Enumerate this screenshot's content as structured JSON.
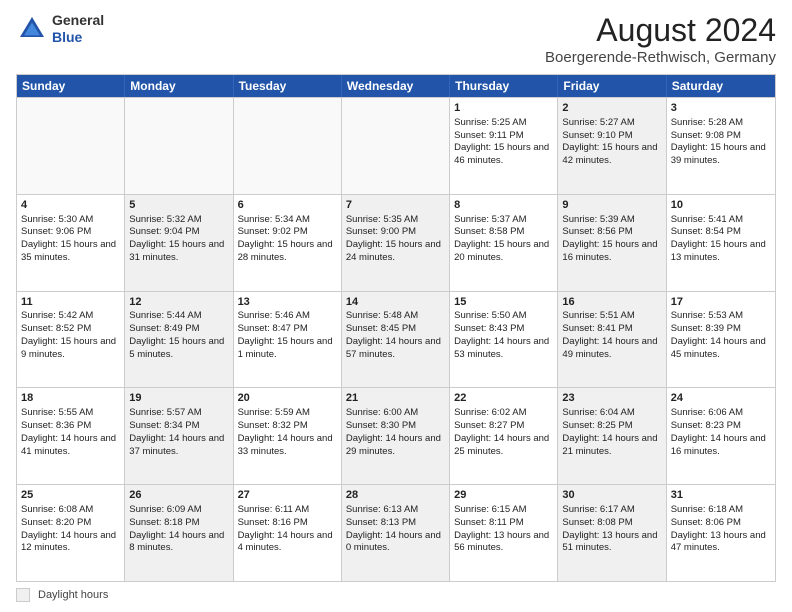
{
  "header": {
    "logo": {
      "line1": "General",
      "line2": "Blue"
    },
    "title": "August 2024",
    "subtitle": "Boergerende-Rethwisch, Germany"
  },
  "weekdays": [
    "Sunday",
    "Monday",
    "Tuesday",
    "Wednesday",
    "Thursday",
    "Friday",
    "Saturday"
  ],
  "rows": [
    [
      {
        "day": "",
        "info": "",
        "shaded": false,
        "empty": true
      },
      {
        "day": "",
        "info": "",
        "shaded": false,
        "empty": true
      },
      {
        "day": "",
        "info": "",
        "shaded": false,
        "empty": true
      },
      {
        "day": "",
        "info": "",
        "shaded": false,
        "empty": true
      },
      {
        "day": "1",
        "info": "Sunrise: 5:25 AM\nSunset: 9:11 PM\nDaylight: 15 hours and 46 minutes.",
        "shaded": false,
        "empty": false
      },
      {
        "day": "2",
        "info": "Sunrise: 5:27 AM\nSunset: 9:10 PM\nDaylight: 15 hours and 42 minutes.",
        "shaded": true,
        "empty": false
      },
      {
        "day": "3",
        "info": "Sunrise: 5:28 AM\nSunset: 9:08 PM\nDaylight: 15 hours and 39 minutes.",
        "shaded": false,
        "empty": false
      }
    ],
    [
      {
        "day": "4",
        "info": "Sunrise: 5:30 AM\nSunset: 9:06 PM\nDaylight: 15 hours and 35 minutes.",
        "shaded": false,
        "empty": false
      },
      {
        "day": "5",
        "info": "Sunrise: 5:32 AM\nSunset: 9:04 PM\nDaylight: 15 hours and 31 minutes.",
        "shaded": true,
        "empty": false
      },
      {
        "day": "6",
        "info": "Sunrise: 5:34 AM\nSunset: 9:02 PM\nDaylight: 15 hours and 28 minutes.",
        "shaded": false,
        "empty": false
      },
      {
        "day": "7",
        "info": "Sunrise: 5:35 AM\nSunset: 9:00 PM\nDaylight: 15 hours and 24 minutes.",
        "shaded": true,
        "empty": false
      },
      {
        "day": "8",
        "info": "Sunrise: 5:37 AM\nSunset: 8:58 PM\nDaylight: 15 hours and 20 minutes.",
        "shaded": false,
        "empty": false
      },
      {
        "day": "9",
        "info": "Sunrise: 5:39 AM\nSunset: 8:56 PM\nDaylight: 15 hours and 16 minutes.",
        "shaded": true,
        "empty": false
      },
      {
        "day": "10",
        "info": "Sunrise: 5:41 AM\nSunset: 8:54 PM\nDaylight: 15 hours and 13 minutes.",
        "shaded": false,
        "empty": false
      }
    ],
    [
      {
        "day": "11",
        "info": "Sunrise: 5:42 AM\nSunset: 8:52 PM\nDaylight: 15 hours and 9 minutes.",
        "shaded": false,
        "empty": false
      },
      {
        "day": "12",
        "info": "Sunrise: 5:44 AM\nSunset: 8:49 PM\nDaylight: 15 hours and 5 minutes.",
        "shaded": true,
        "empty": false
      },
      {
        "day": "13",
        "info": "Sunrise: 5:46 AM\nSunset: 8:47 PM\nDaylight: 15 hours and 1 minute.",
        "shaded": false,
        "empty": false
      },
      {
        "day": "14",
        "info": "Sunrise: 5:48 AM\nSunset: 8:45 PM\nDaylight: 14 hours and 57 minutes.",
        "shaded": true,
        "empty": false
      },
      {
        "day": "15",
        "info": "Sunrise: 5:50 AM\nSunset: 8:43 PM\nDaylight: 14 hours and 53 minutes.",
        "shaded": false,
        "empty": false
      },
      {
        "day": "16",
        "info": "Sunrise: 5:51 AM\nSunset: 8:41 PM\nDaylight: 14 hours and 49 minutes.",
        "shaded": true,
        "empty": false
      },
      {
        "day": "17",
        "info": "Sunrise: 5:53 AM\nSunset: 8:39 PM\nDaylight: 14 hours and 45 minutes.",
        "shaded": false,
        "empty": false
      }
    ],
    [
      {
        "day": "18",
        "info": "Sunrise: 5:55 AM\nSunset: 8:36 PM\nDaylight: 14 hours and 41 minutes.",
        "shaded": false,
        "empty": false
      },
      {
        "day": "19",
        "info": "Sunrise: 5:57 AM\nSunset: 8:34 PM\nDaylight: 14 hours and 37 minutes.",
        "shaded": true,
        "empty": false
      },
      {
        "day": "20",
        "info": "Sunrise: 5:59 AM\nSunset: 8:32 PM\nDaylight: 14 hours and 33 minutes.",
        "shaded": false,
        "empty": false
      },
      {
        "day": "21",
        "info": "Sunrise: 6:00 AM\nSunset: 8:30 PM\nDaylight: 14 hours and 29 minutes.",
        "shaded": true,
        "empty": false
      },
      {
        "day": "22",
        "info": "Sunrise: 6:02 AM\nSunset: 8:27 PM\nDaylight: 14 hours and 25 minutes.",
        "shaded": false,
        "empty": false
      },
      {
        "day": "23",
        "info": "Sunrise: 6:04 AM\nSunset: 8:25 PM\nDaylight: 14 hours and 21 minutes.",
        "shaded": true,
        "empty": false
      },
      {
        "day": "24",
        "info": "Sunrise: 6:06 AM\nSunset: 8:23 PM\nDaylight: 14 hours and 16 minutes.",
        "shaded": false,
        "empty": false
      }
    ],
    [
      {
        "day": "25",
        "info": "Sunrise: 6:08 AM\nSunset: 8:20 PM\nDaylight: 14 hours and 12 minutes.",
        "shaded": false,
        "empty": false
      },
      {
        "day": "26",
        "info": "Sunrise: 6:09 AM\nSunset: 8:18 PM\nDaylight: 14 hours and 8 minutes.",
        "shaded": true,
        "empty": false
      },
      {
        "day": "27",
        "info": "Sunrise: 6:11 AM\nSunset: 8:16 PM\nDaylight: 14 hours and 4 minutes.",
        "shaded": false,
        "empty": false
      },
      {
        "day": "28",
        "info": "Sunrise: 6:13 AM\nSunset: 8:13 PM\nDaylight: 14 hours and 0 minutes.",
        "shaded": true,
        "empty": false
      },
      {
        "day": "29",
        "info": "Sunrise: 6:15 AM\nSunset: 8:11 PM\nDaylight: 13 hours and 56 minutes.",
        "shaded": false,
        "empty": false
      },
      {
        "day": "30",
        "info": "Sunrise: 6:17 AM\nSunset: 8:08 PM\nDaylight: 13 hours and 51 minutes.",
        "shaded": true,
        "empty": false
      },
      {
        "day": "31",
        "info": "Sunrise: 6:18 AM\nSunset: 8:06 PM\nDaylight: 13 hours and 47 minutes.",
        "shaded": false,
        "empty": false
      }
    ]
  ],
  "legend": {
    "label": "Daylight hours"
  }
}
